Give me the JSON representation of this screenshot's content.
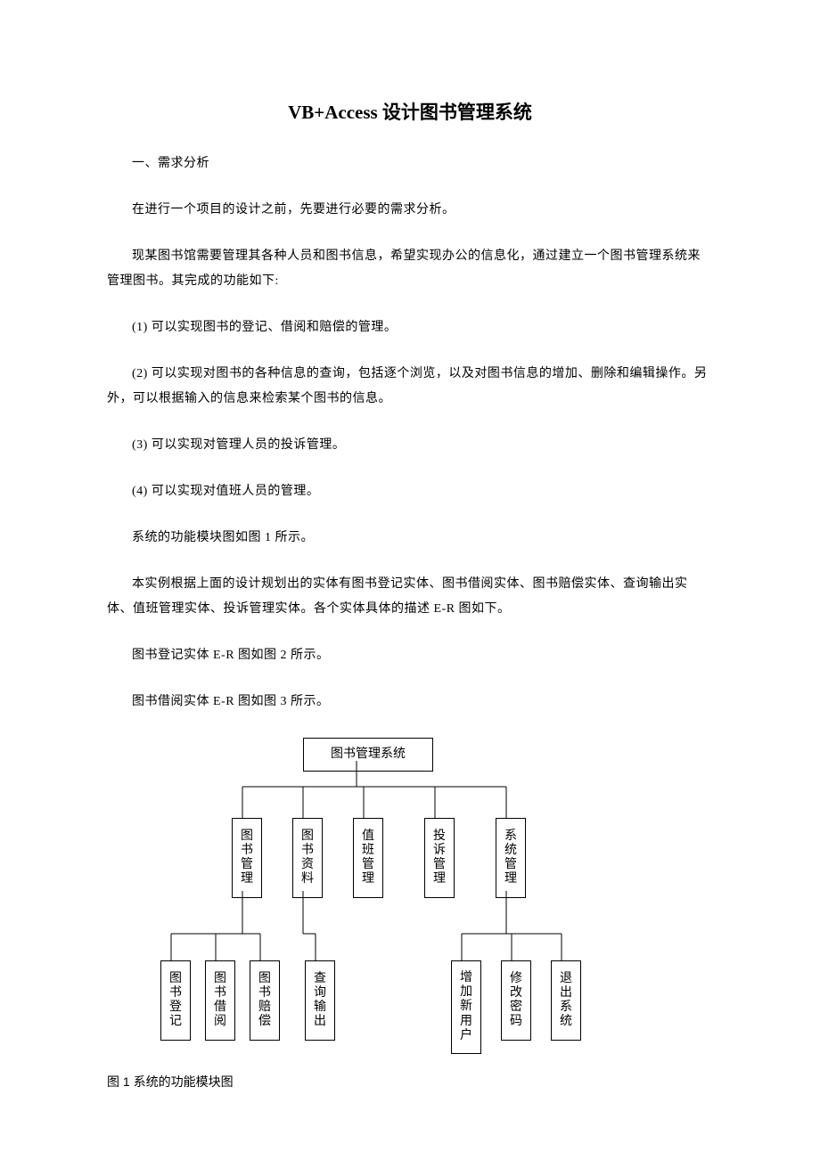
{
  "title": "VB+Access 设计图书管理系统",
  "section_heading": "一、需求分析",
  "paragraphs": {
    "p1": "在进行一个项目的设计之前，先要进行必要的需求分析。",
    "p2": "现某图书馆需要管理其各种人员和图书信息，希望实现办公的信息化，通过建立一个图书管理系统来管理图书。其完成的功能如下:",
    "p3": "(1) 可以实现图书的登记、借阅和赔偿的管理。",
    "p4": "(2) 可以实现对图书的各种信息的查询，包括逐个浏览，以及对图书信息的增加、删除和编辑操作。另外，可以根据输入的信息来检索某个图书的信息。",
    "p5": "(3) 可以实现对管理人员的投诉管理。",
    "p6": "(4) 可以实现对值班人员的管理。",
    "p7": "系统的功能模块图如图 1 所示。",
    "p8": "本实例根据上面的设计规划出的实体有图书登记实体、图书借阅实体、图书赔偿实体、查询输出实体、值班管理实体、投诉管理实体。各个实体具体的描述 E-R 图如下。",
    "p9": "图书登记实体 E-R 图如图 2 所示。",
    "p10": "图书借阅实体 E-R 图如图 3 所示。"
  },
  "chart_data": {
    "type": "tree",
    "root": "图书管理系统",
    "level2": [
      "图书管理",
      "图书资料",
      "值班管理",
      "投诉管理",
      "系统管理"
    ],
    "level3_left_parent": [
      "图书管理",
      "图书资料"
    ],
    "level3_left": [
      "图书登记",
      "图书借阅",
      "图书赔偿",
      "查询输出"
    ],
    "level3_right_parent": "系统管理",
    "level3_right": [
      "增加新用户",
      "修改密码",
      "退出系统"
    ]
  },
  "caption": "图 1 系统的功能模块图"
}
